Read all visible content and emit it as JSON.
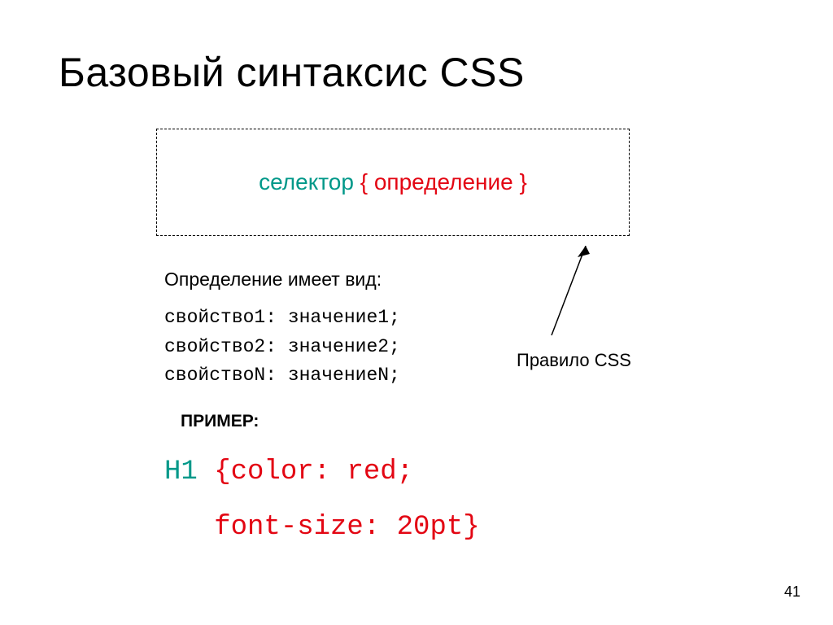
{
  "title": "Базовый синтаксис CSS",
  "rule_box": {
    "selector": "селектор",
    "brace_open": "{",
    "definition": "определение",
    "brace_close": "}"
  },
  "subtitle": "Определение имеет вид:",
  "properties": [
    "свойство1: значение1;",
    "свойство2: значение2;",
    "свойствоN: значениеN;"
  ],
  "example_label": "ПРИМЕР:",
  "example": {
    "selector": "H1",
    "line1": " {color: red;",
    "line2": "   font-size: 20pt}"
  },
  "rule_label": "Правило CSS",
  "page_number": "41"
}
